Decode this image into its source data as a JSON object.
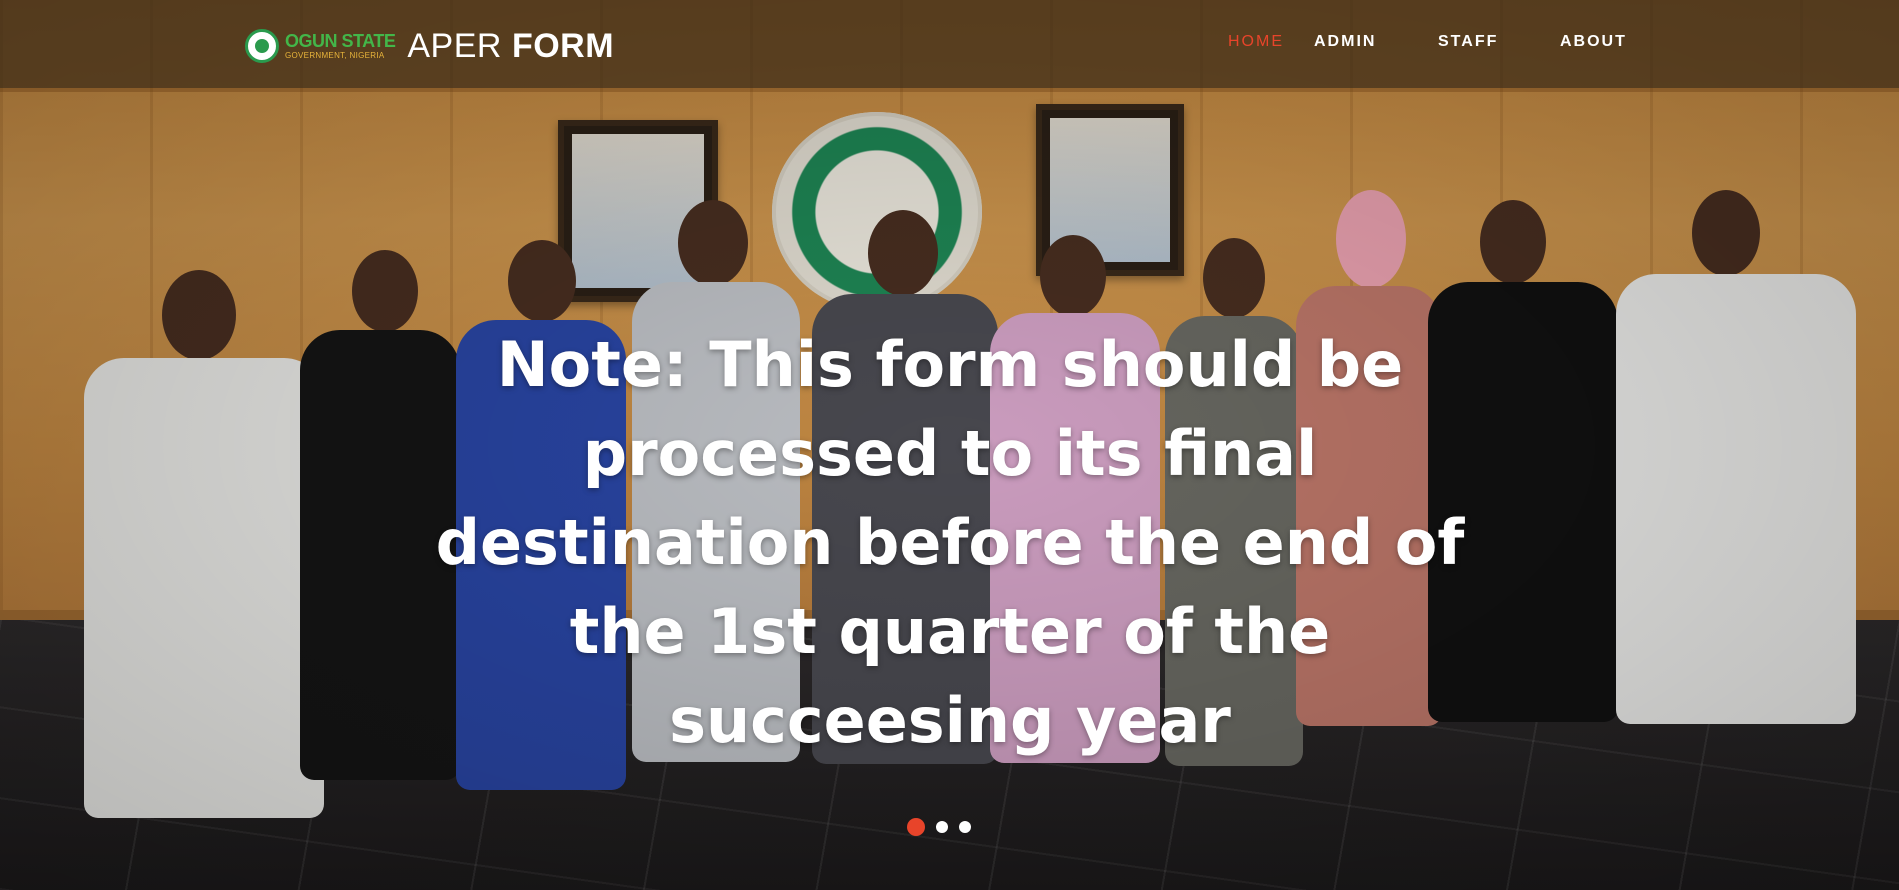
{
  "brand": {
    "logo_main": "OGUN STATE",
    "logo_sub": "GOVERNMENT, NIGERIA",
    "title_light": "APER",
    "title_bold": "FORM"
  },
  "nav": {
    "items": [
      {
        "label": "HOME",
        "active": true
      },
      {
        "label": "ADMIN",
        "active": false
      },
      {
        "label": "STAFF",
        "active": false
      },
      {
        "label": "ABOUT",
        "active": false
      }
    ]
  },
  "hero": {
    "caption": "Note: This form should be processed to its final destination before the end of the 1st quarter of the succeesing year"
  },
  "carousel": {
    "slides": 3,
    "active_index": 0
  },
  "colors": {
    "accent": "#e8442a",
    "brand_green": "#43b649",
    "navbar_bg": "rgba(58,42,22,0.72)"
  }
}
